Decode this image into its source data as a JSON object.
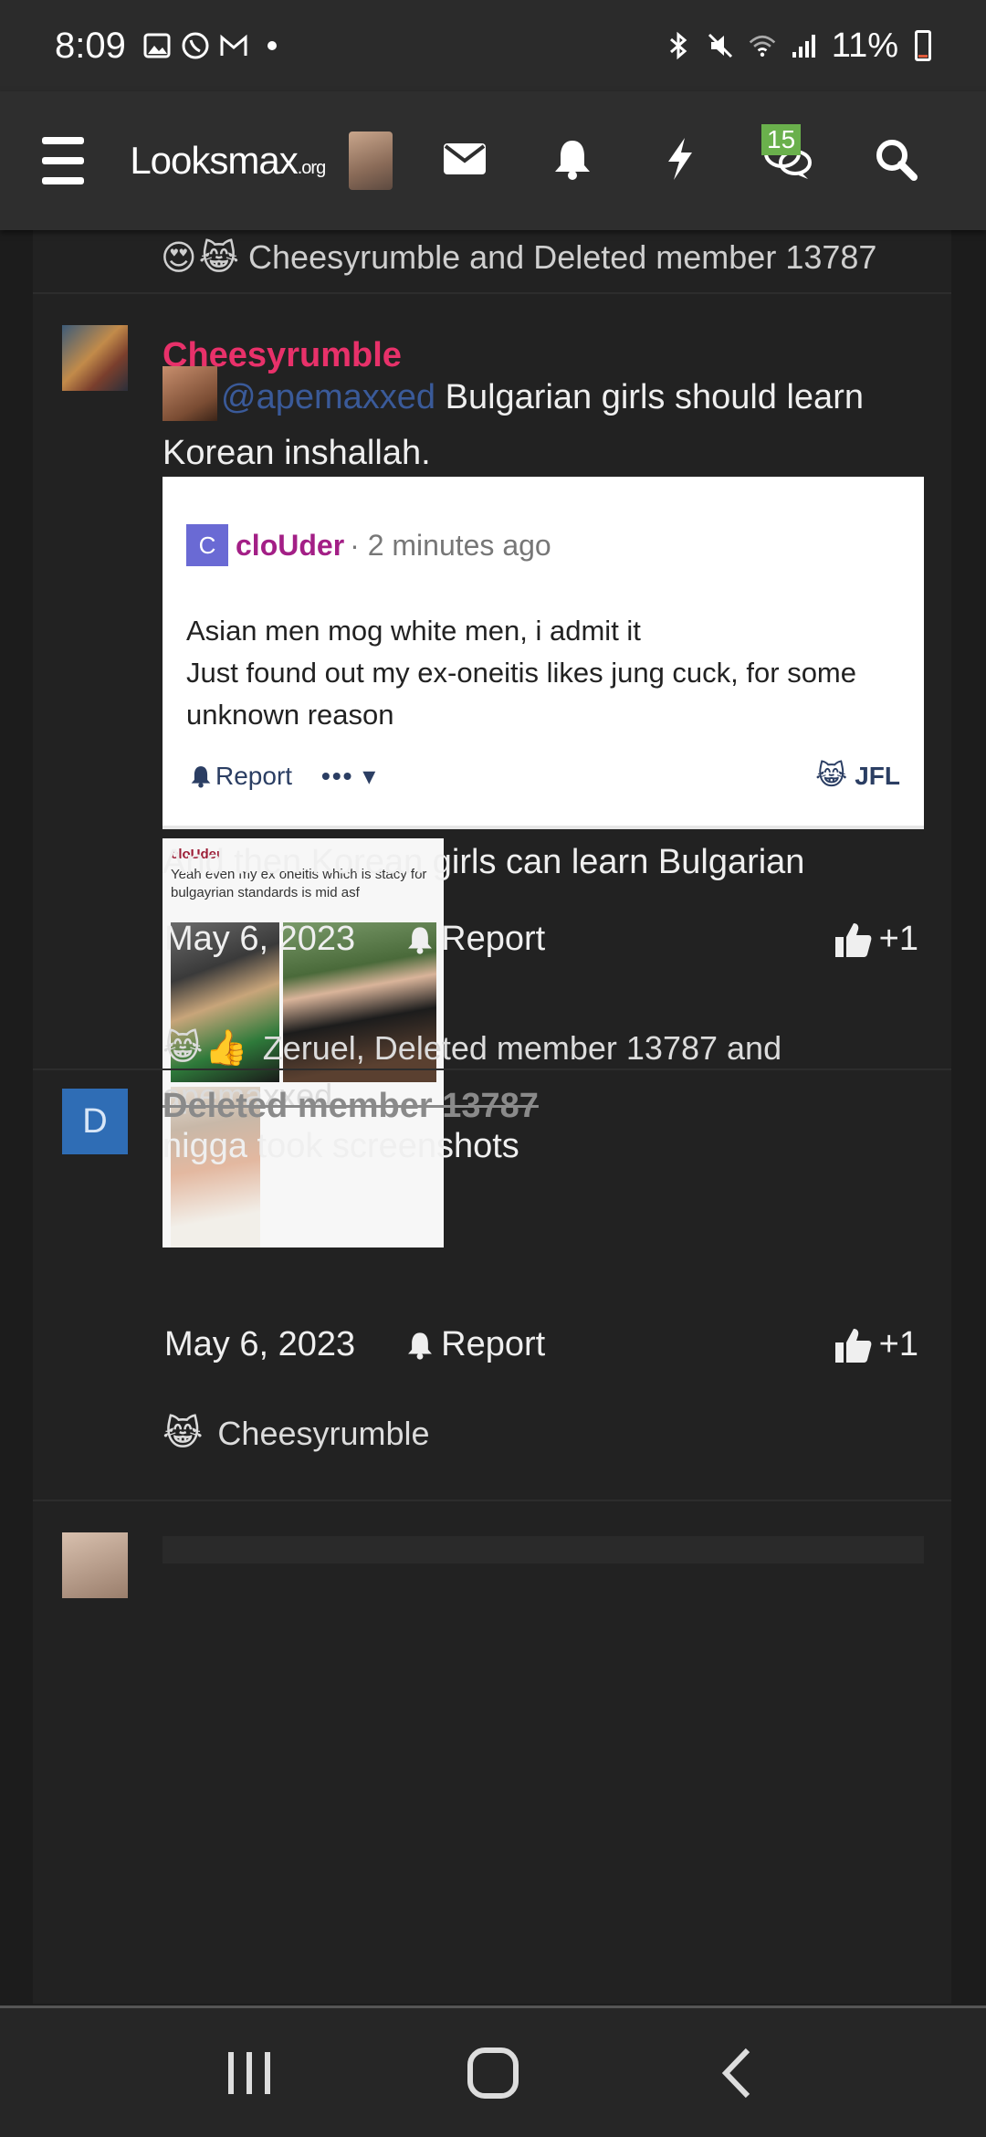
{
  "status_bar": {
    "time": "8:09",
    "battery": "11%"
  },
  "header": {
    "logo_main": "Looksmax",
    "logo_suffix": ".org",
    "conversations_badge": "15",
    "icons": [
      "hamburger-menu-icon",
      "avatar",
      "envelope-icon",
      "bell-icon",
      "bolt-icon",
      "chat-bubbles-icon",
      "search-icon"
    ]
  },
  "prev_post": {
    "reactions_text": "Cheesyrumble and Deleted member 13787"
  },
  "post1": {
    "username": "Cheesyrumble",
    "mention": "@apemaxxed",
    "text_after_mention": " Bulgarian girls should learn Korean inshallah.",
    "embed": {
      "avatar_letter": "C",
      "username": "cloUder",
      "time": "· 2 minutes ago",
      "text_line1": "Asian men mog white men, i admit it",
      "text_line2": "Just found out my ex-oneitis likes jung cuck, for some unknown reason",
      "report": "Report",
      "more": "•••",
      "reaction": "JFL"
    },
    "screenshot": {
      "name": "cloUder",
      "text": "Yeah even my ex oneitis which is stacy for bulgayrian standards is mid asf"
    },
    "text2": "And then Korean girls can learn Bulgarian",
    "date": "May 6, 2023",
    "report": "Report",
    "likes": "+1",
    "reactions_text": "Zeruel, Deleted member 13787 and apemaxxed"
  },
  "post2": {
    "avatar_letter": "D",
    "username": "Deleted member 13787",
    "text": "nigga took screenshots",
    "date": "May 6, 2023",
    "report": "Report",
    "likes": "+1",
    "reactions_text": "Cheesyrumble"
  },
  "colors": {
    "username_pink": "#e8316a",
    "embed_user": "#a31f86",
    "mention_blue": "#3a5a99",
    "badge_green": "#6ab04c",
    "deleted_avatar": "#2f6db5"
  }
}
